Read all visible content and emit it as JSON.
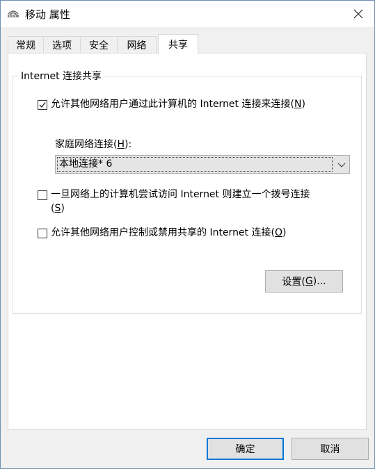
{
  "window": {
    "title": "移动 属性",
    "close_icon": "close-icon"
  },
  "tabs": [
    {
      "label": "常规"
    },
    {
      "label": "选项"
    },
    {
      "label": "安全"
    },
    {
      "label": "网络"
    },
    {
      "label": "共享",
      "active": true
    }
  ],
  "sharing": {
    "group_title": "Internet 连接共享",
    "allow_share": {
      "label": "允许其他网络用户通过此计算机的 Internet 连接来连接(",
      "key": "N",
      "tail": ")",
      "checked": true
    },
    "home_network": {
      "label_prefix": "家庭网络连接(",
      "key": "H",
      "label_suffix": "):",
      "selected": "本地连接* 6"
    },
    "dial_on_demand": {
      "label": "一旦网络上的计算机尝试访问 Internet 则建立一个拨号连接",
      "line2_prefix": "(",
      "key": "S",
      "line2_suffix": ")",
      "checked": false
    },
    "allow_control": {
      "label": "允许其他网络用户控制或禁用共享的 Internet 连接(",
      "key": "O",
      "tail": ")",
      "checked": false
    },
    "settings_button": {
      "prefix": "设置(",
      "key": "G",
      "suffix": ")..."
    }
  },
  "footer": {
    "ok_label": "确定",
    "cancel_label": "取消"
  }
}
